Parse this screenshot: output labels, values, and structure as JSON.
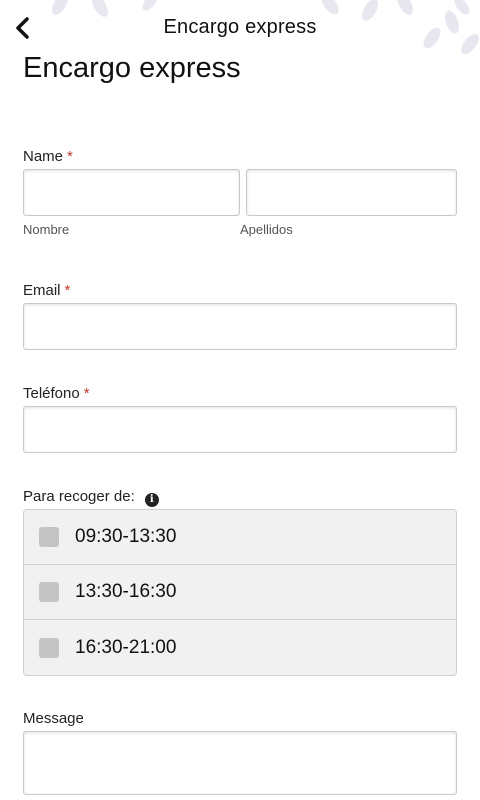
{
  "header": {
    "title": "Encargo express",
    "back_icon": "chevron-left-icon"
  },
  "page": {
    "title": "Encargo express"
  },
  "form": {
    "name": {
      "label": "Name",
      "required_mark": "*",
      "first_sublabel": "Nombre",
      "last_sublabel": "Apellidos",
      "first_value": "",
      "last_value": ""
    },
    "email": {
      "label": "Email",
      "required_mark": "*",
      "value": ""
    },
    "phone": {
      "label": "Teléfono",
      "required_mark": "*",
      "value": ""
    },
    "pickup": {
      "label": "Para recoger de:",
      "info_icon": "info-icon",
      "options": [
        {
          "label": "09:30-13:30",
          "checked": false
        },
        {
          "label": "13:30-16:30",
          "checked": false
        },
        {
          "label": "16:30-21:00",
          "checked": false
        }
      ]
    },
    "message": {
      "label": "Message",
      "value": ""
    }
  },
  "colors": {
    "required": "#c0392b",
    "checkbox": "#c4c4c4",
    "slot_bg": "#f1f1f1",
    "leaf": "#e6e4ee"
  }
}
